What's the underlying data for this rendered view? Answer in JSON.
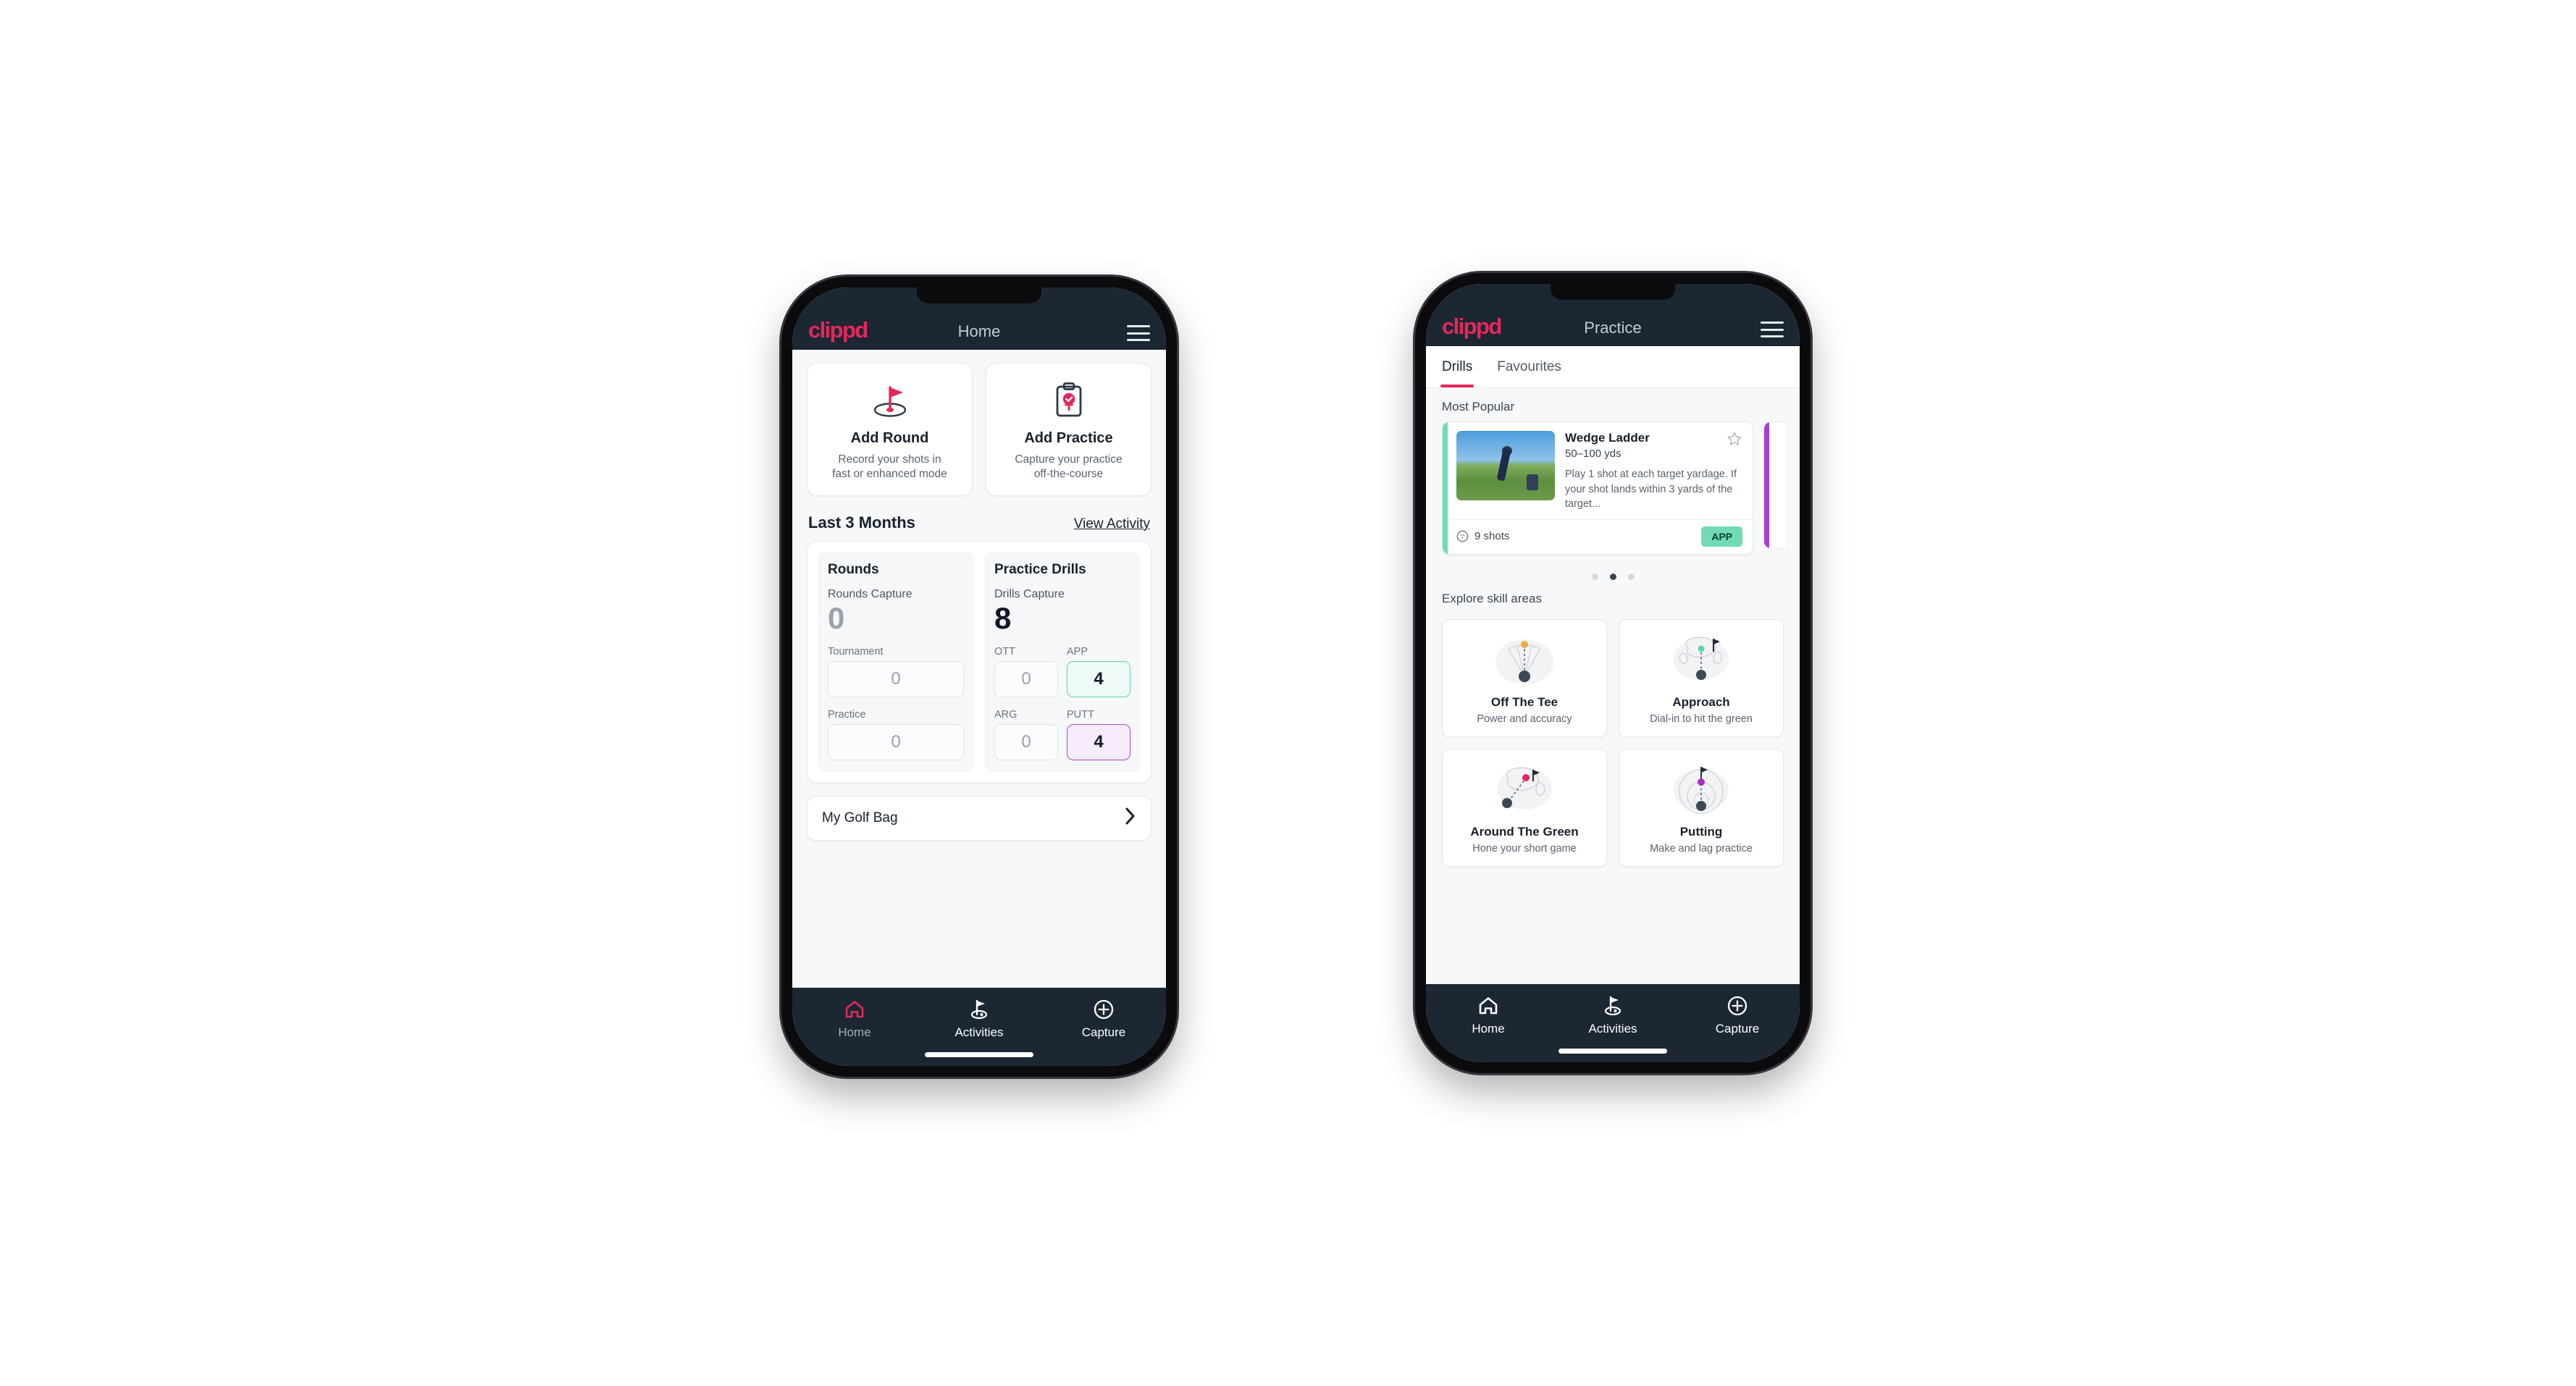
{
  "colors": {
    "brand_pink": "#e5275b",
    "header_navy": "#1b2733",
    "app_green": "#6fdcb4",
    "putt_purple": "#a846cc",
    "page_bg": "#f7f8fa"
  },
  "home_phone": {
    "appbar": {
      "logo": "clippd",
      "title": "Home",
      "menu_icon": "hamburger-menu-icon"
    },
    "quick_actions": [
      {
        "icon": "golf-flag-hole-icon",
        "title": "Add Round",
        "subtitle_line1": "Record your shots in",
        "subtitle_line2": "fast or enhanced mode"
      },
      {
        "icon": "clipboard-check-icon",
        "title": "Add Practice",
        "subtitle_line1": "Capture your practice",
        "subtitle_line2": "off-the-course"
      }
    ],
    "section": {
      "title": "Last 3 Months",
      "link": "View Activity"
    },
    "stats": {
      "rounds": {
        "heading": "Rounds",
        "capture_label": "Rounds Capture",
        "capture_value": "0",
        "fields": [
          {
            "label": "Tournament",
            "value": "0",
            "state": "default"
          },
          {
            "label": "Practice",
            "value": "0",
            "state": "default"
          }
        ]
      },
      "practice_drills": {
        "heading": "Practice Drills",
        "capture_label": "Drills Capture",
        "capture_value": "8",
        "fields": [
          {
            "label": "OTT",
            "value": "0",
            "state": "default"
          },
          {
            "label": "APP",
            "value": "4",
            "state": "app"
          },
          {
            "label": "ARG",
            "value": "0",
            "state": "default"
          },
          {
            "label": "PUTT",
            "value": "4",
            "state": "putt"
          }
        ]
      }
    },
    "golf_bag": {
      "label": "My Golf Bag",
      "chevron_icon": "chevron-right-icon"
    },
    "bottom_nav": [
      {
        "label": "Home",
        "icon": "home-icon",
        "active": true
      },
      {
        "label": "Activities",
        "icon": "golf-flag-icon",
        "active": false
      },
      {
        "label": "Capture",
        "icon": "plus-circle-icon",
        "active": false
      }
    ]
  },
  "practice_phone": {
    "appbar": {
      "logo": "clippd",
      "title": "Practice",
      "menu_icon": "hamburger-menu-icon"
    },
    "tabs": [
      {
        "label": "Drills",
        "active": true
      },
      {
        "label": "Favourites",
        "active": false
      }
    ],
    "most_popular": {
      "heading": "Most Popular",
      "drill": {
        "title": "Wedge Ladder",
        "yardage": "50–100 yds",
        "description": "Play 1 shot at each target yardage. If your shot lands within 3 yards of the target...",
        "shots": "9 shots",
        "shots_icon": "golf-ball-icon",
        "tag": "APP",
        "tag_color": "#6fdcb4",
        "accent_color": "#6fdcb4",
        "favourite_icon": "star-outline-icon",
        "thumbnail": "golfer-wedge-shot-photo"
      },
      "next_card_accent": "#ab3ed6",
      "dots": {
        "count": 3,
        "active_index": 1
      }
    },
    "skill_areas": {
      "heading": "Explore skill areas",
      "cards": [
        {
          "title": "Off The Tee",
          "subtitle": "Power and accuracy",
          "icon": "tee-shot-dispersion-icon",
          "dot_color": "#f2a93b"
        },
        {
          "title": "Approach",
          "subtitle": "Dial-in to hit the green",
          "icon": "approach-green-icon",
          "dot_color": "#5fd3b2"
        },
        {
          "title": "Around The Green",
          "subtitle": "Hone your short game",
          "icon": "chip-around-green-icon",
          "dot_color": "#e5275b"
        },
        {
          "title": "Putting",
          "subtitle": "Make and lag practice",
          "icon": "putting-rings-icon",
          "dot_color": "#a32fc7"
        }
      ]
    },
    "bottom_nav": [
      {
        "label": "Home",
        "icon": "home-icon",
        "active": false
      },
      {
        "label": "Activities",
        "icon": "golf-flag-icon",
        "active": true
      },
      {
        "label": "Capture",
        "icon": "plus-circle-icon",
        "active": false
      }
    ]
  }
}
